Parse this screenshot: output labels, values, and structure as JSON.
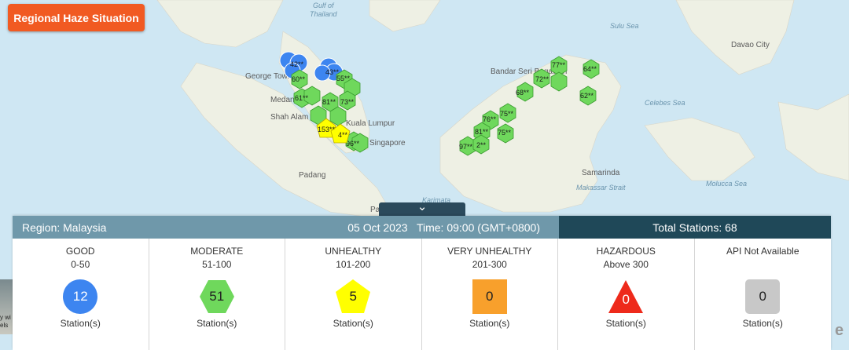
{
  "header": {
    "title": "Regional Haze Situation"
  },
  "map": {
    "labels": {
      "gulf_thailand": "Gulf of Thailand",
      "sulu_sea": "Sulu Sea",
      "davao": "Davao City",
      "george_town": "George Town",
      "medan": "Medan",
      "shah_alam": "Shah Alam",
      "kuala_lumpur": "Kuala Lumpur",
      "singapore": "Singapore",
      "padang": "Padang",
      "bandar": "Bandar Seri Begawan",
      "celebes": "Celebes Sea",
      "samarinda": "Samarinda",
      "makassar": "Makassar Strait",
      "molucca": "Molucca Sea",
      "karimata": "Karimata",
      "pa": "Pa"
    },
    "markers_labels": {
      "m42": "42**",
      "m60": "60**",
      "m43": "43**",
      "m55": "55**",
      "m61": "61**",
      "m81a": "81**",
      "m73": "73**",
      "m153": "153**",
      "m4": "4**",
      "m96": "96**",
      "m77": "77**",
      "m64": "64**",
      "m72": "72**",
      "m68": "68**",
      "m62": "62**",
      "m76": "76**",
      "m75a": "75**",
      "m81b": "81**",
      "m75b": "75**",
      "m97": "97**",
      "m2": "2**"
    },
    "colors": {
      "good": "#3d85f0",
      "moderate": "#6fd85c",
      "unhealthy": "#ffff00",
      "very_unhealthy": "#f8a02c",
      "hazardous": "#ee2a1b",
      "na": "#c8c8c8",
      "land": "#eef0e4",
      "sea": "#cfe7f3"
    }
  },
  "panel": {
    "toggle_icon": "chevron-down-icon",
    "toggle_glyph": "⌄",
    "region_label": "Region: Malaysia",
    "date_time": "05 Oct 2023   Time: 09:00 (GMT+0800)",
    "total_stations": "Total Stations: 68",
    "categories": [
      {
        "name": "GOOD",
        "range": "0-50",
        "count": "12",
        "unit": "Station(s)",
        "color": "#3d85f0",
        "shape": "circle"
      },
      {
        "name": "MODERATE",
        "range": "51-100",
        "count": "51",
        "unit": "Station(s)",
        "color": "#6fd85c",
        "shape": "hexagon"
      },
      {
        "name": "UNHEALTHY",
        "range": "101-200",
        "count": "5",
        "unit": "Station(s)",
        "color": "#ffff00",
        "shape": "pentagon"
      },
      {
        "name": "VERY UNHEALTHY",
        "range": "201-300",
        "count": "0",
        "unit": "Station(s)",
        "color": "#f8a02c",
        "shape": "square"
      },
      {
        "name": "HAZARDOUS",
        "range": "Above 300",
        "count": "0",
        "unit": "Station(s)",
        "color": "#ee2a1b",
        "shape": "triangle"
      },
      {
        "name": "API Not Available",
        "range": "",
        "count": "0",
        "unit": "Station(s)",
        "color": "#c8c8c8",
        "shape": "rounded-square"
      }
    ]
  },
  "thumbnail": {
    "text": "y wi\nels"
  },
  "esri": {
    "logo_glyph": "e"
  }
}
